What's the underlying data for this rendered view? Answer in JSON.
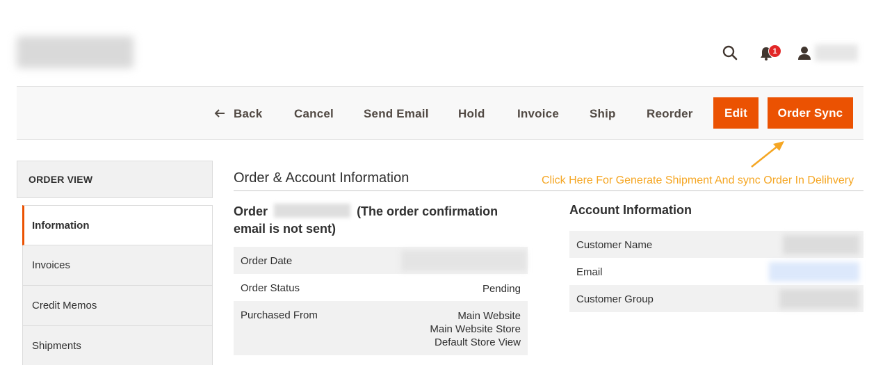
{
  "header": {
    "notification_count": "1"
  },
  "toolbar": {
    "back_label": "Back",
    "cancel_label": "Cancel",
    "send_email_label": "Send Email",
    "hold_label": "Hold",
    "invoice_label": "Invoice",
    "ship_label": "Ship",
    "reorder_label": "Reorder",
    "edit_label": "Edit",
    "order_sync_label": "Order Sync",
    "accent_color": "#eb5202"
  },
  "annotation": {
    "text": "Click Here For Generate Shipment And sync Order In Delihvery",
    "color": "#f5a623"
  },
  "sidebar": {
    "title": "ORDER VIEW",
    "items": [
      {
        "label": "Information",
        "active": true
      },
      {
        "label": "Invoices"
      },
      {
        "label": "Credit Memos"
      },
      {
        "label": "Shipments"
      }
    ]
  },
  "main": {
    "section_title": "Order & Account Information",
    "order_heading_prefix": "Order",
    "order_heading_suffix": "(The order confirmation email is not sent)",
    "order_info": [
      {
        "label": "Order Date",
        "value": ""
      },
      {
        "label": "Order Status",
        "value": "Pending"
      },
      {
        "label": "Purchased From",
        "lines": [
          "Main Website",
          "Main Website Store",
          "Default Store View"
        ]
      }
    ],
    "account": {
      "title": "Account Information",
      "rows": [
        {
          "label": "Customer Name"
        },
        {
          "label": "Email"
        },
        {
          "label": "Customer Group"
        }
      ]
    }
  }
}
